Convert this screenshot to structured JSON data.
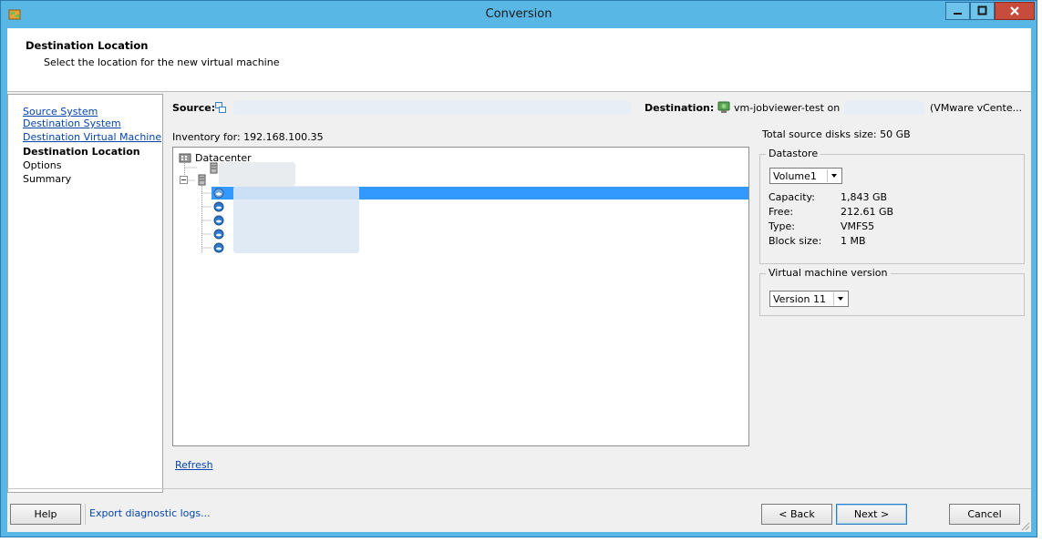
{
  "window": {
    "title": "Conversion"
  },
  "header": {
    "title": "Destination Location",
    "subtitle": "Select the location for the new virtual machine"
  },
  "nav": {
    "items": [
      {
        "label": "Source System"
      },
      {
        "label": "Destination System"
      },
      {
        "label": "Destination Virtual Machine"
      },
      {
        "label": "Destination Location"
      },
      {
        "label": "Options"
      },
      {
        "label": "Summary"
      }
    ]
  },
  "source": {
    "label": "Source:"
  },
  "destination": {
    "label": "Destination:",
    "value": "vm-jobviewer-test on",
    "suffix": "(VMware vCente..."
  },
  "inventory": {
    "label": "Inventory for: 192.168.100.35",
    "tree": {
      "root": "Datacenter"
    }
  },
  "refresh_label": "Refresh",
  "disk_info": {
    "total_label": "Total source disks size: 50 GB"
  },
  "datastore": {
    "group_label": "Datastore",
    "selected": "Volume1",
    "rows": [
      {
        "key": "Capacity:",
        "value": "1,843 GB"
      },
      {
        "key": "Free:",
        "value": "212.61 GB"
      },
      {
        "key": "Type:",
        "value": "VMFS5"
      },
      {
        "key": "Block size:",
        "value": "1 MB"
      }
    ]
  },
  "vm_version": {
    "group_label": "Virtual machine version",
    "selected": "Version 11"
  },
  "footer": {
    "help": "Help",
    "export_logs": "Export diagnostic logs...",
    "back": "< Back",
    "next": "Next >",
    "cancel": "Cancel"
  },
  "colors": {
    "titlebar": "#58b7e4",
    "selection": "#3399ff",
    "link": "#0645ad",
    "close_button": "#c74c3c"
  }
}
